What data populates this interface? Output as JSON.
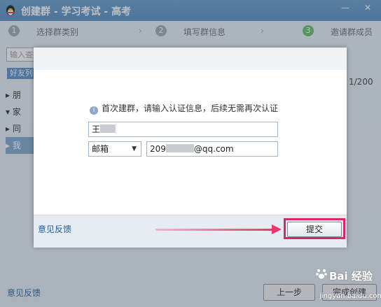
{
  "window": {
    "title": "创建群 - 学习考试 - 高考",
    "minimize_glyph": "—",
    "close_glyph": "✕"
  },
  "steps": [
    {
      "num": "1",
      "label": "选择群类别"
    },
    {
      "num": "2",
      "label": "填写群信息"
    },
    {
      "num": "3",
      "label": "邀请群成员"
    }
  ],
  "step_arrow": "›",
  "left": {
    "search_placeholder": "输入查找关键字",
    "friend_tab": "好友列",
    "items": [
      {
        "arrow": "▸",
        "text": "朋"
      },
      {
        "arrow": "▾",
        "text": "家"
      },
      {
        "arrow": "▸",
        "text": "同"
      },
      {
        "arrow": "▸",
        "text": "我"
      }
    ]
  },
  "member_count": "1/200",
  "dialog": {
    "info_icon": "i",
    "info_text": "首次建群，请输入认证信息，后续无需再次认证",
    "name_value_visible": "王",
    "name_value_tail": "",
    "contact_type": "邮箱",
    "select_arrow": "▼",
    "email_prefix": "209",
    "email_suffix": "@qq.com",
    "feedback_link": "意见反馈",
    "submit_label": "提交"
  },
  "bottom": {
    "feedback_link": "意见反馈",
    "prev_label": "上一步",
    "finish_label": "完成创建"
  },
  "watermark": {
    "text": "Bai 经验",
    "sub": "jingyan.baidu.com"
  },
  "colors": {
    "titlebar": "#4f86bd",
    "highlight": "#d9286a",
    "link": "#1c5a9c",
    "step_active": "#5cb85c"
  }
}
